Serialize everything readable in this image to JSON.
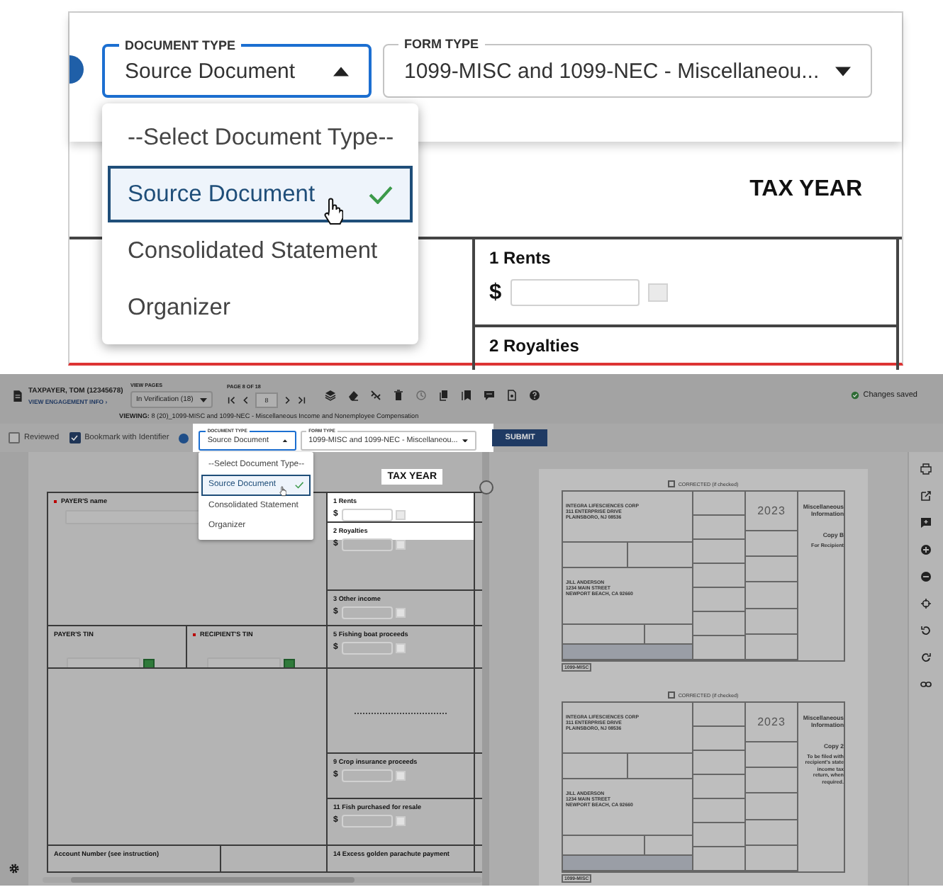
{
  "callout": {
    "document_type": {
      "label": "DOCUMENT TYPE",
      "value": "Source Document",
      "expanded": true
    },
    "form_type": {
      "label": "FORM TYPE",
      "value": "1099-MISC and 1099-NEC - Miscellaneou...",
      "expanded": false
    },
    "options": [
      {
        "label": "--Select Document Type--",
        "selected": false
      },
      {
        "label": "Source Document",
        "selected": true
      },
      {
        "label": "Consolidated Statement",
        "selected": false
      },
      {
        "label": "Organizer",
        "selected": false
      }
    ],
    "tax_year": "TAX YEAR",
    "fields": [
      {
        "kind": "amount",
        "label": "1 Rents",
        "currency": "$"
      },
      {
        "kind": "label",
        "label": "2 Royalties"
      }
    ]
  },
  "app": {
    "taxpayer": "TAXPAYER, TOM (12345678)",
    "engagement_link": "VIEW ENGAGEMENT INFO ›",
    "view_pages": {
      "label": "VIEW PAGES",
      "value": "In Verification (18)"
    },
    "page": {
      "label": "PAGE 8 OF 18",
      "value": "8"
    },
    "viewing": {
      "label": "VIEWING:",
      "value": "8 (20)_1099-MISC and 1099-NEC - Miscellaneous Income and Nonemployee Compensation"
    },
    "save_status": "Changes saved",
    "checks": [
      {
        "label": "Reviewed",
        "checked": false
      },
      {
        "label": "Bookmark with Identifier",
        "checked": true
      }
    ],
    "document_type": {
      "label": "DOCUMENT TYPE",
      "value": "Source Document",
      "expanded": true
    },
    "form_type": {
      "label": "FORM TYPE",
      "value": "1099-MISC and 1099-NEC - Miscellaneou...",
      "expanded": false
    },
    "options": [
      {
        "label": "--Select Document Type--",
        "selected": false
      },
      {
        "label": "Source Document",
        "selected": true
      },
      {
        "label": "Consolidated Statement",
        "selected": false
      },
      {
        "label": "Organizer",
        "selected": false
      }
    ],
    "submit": "SUBMIT",
    "tax_year": "TAX YEAR",
    "form": {
      "left": [
        {
          "cells": [
            {
              "kind": "text",
              "label": "PAYER'S name",
              "required": true
            }
          ]
        },
        {
          "cells": [
            {
              "kind": "tin",
              "label": "PAYER'S TIN",
              "required": false
            },
            {
              "kind": "tin",
              "label": "RECIPIENT'S TIN",
              "required": true
            }
          ]
        },
        {
          "cells": [
            {
              "kind": "blank"
            }
          ]
        },
        {
          "cells": [
            {
              "kind": "label",
              "label": "Account Number (see instruction)"
            },
            {
              "kind": "blank"
            }
          ]
        }
      ],
      "right": [
        {
          "kind": "amount",
          "label": "1 Rents",
          "currency": "$"
        },
        {
          "kind": "amount",
          "label": "2 Royalties",
          "currency": "$"
        },
        {
          "kind": "amount",
          "label": "3 Other income",
          "currency": "$"
        },
        {
          "kind": "amount",
          "label": "5 Fishing boat proceeds",
          "currency": "$"
        },
        {
          "kind": "dotted"
        },
        {
          "kind": "amount",
          "label": "9 Crop insurance proceeds",
          "currency": "$"
        },
        {
          "kind": "amount",
          "label": "11 Fish purchased for resale",
          "currency": "$"
        },
        {
          "kind": "label",
          "label": "14 Excess golden parachute payment"
        }
      ]
    },
    "documents": [
      {
        "corrected": "CORRECTED (if checked)",
        "corrected_checked": false,
        "year": "2023",
        "title": "Miscellaneous Information",
        "copy": "Copy B",
        "copy_note": "For Recipient",
        "payer": [
          "INTEGRA LIFESCIENCES CORP",
          "311 ENTERPRISE DRIVE",
          "PLAINSBORO, NJ 08536"
        ],
        "recipient": [
          "JILL ANDERSON",
          "1234 MAIN STREET",
          "NEWPORT BEACH, CA 92660"
        ],
        "form": "1099-MISC"
      },
      {
        "corrected": "CORRECTED (if checked)",
        "corrected_checked": false,
        "year": "2023",
        "title": "Miscellaneous Information",
        "copy": "Copy 2",
        "copy_note": "To be filed with recipient's state income tax return, when required.",
        "payer": [
          "INTEGRA LIFESCIENCES CORP",
          "311 ENTERPRISE DRIVE",
          "PLAINSBORO, NJ 08536"
        ],
        "recipient": [
          "JILL ANDERSON",
          "1234 MAIN STREET",
          "NEWPORT BEACH, CA 92660"
        ],
        "form": "1099-MISC"
      }
    ]
  }
}
